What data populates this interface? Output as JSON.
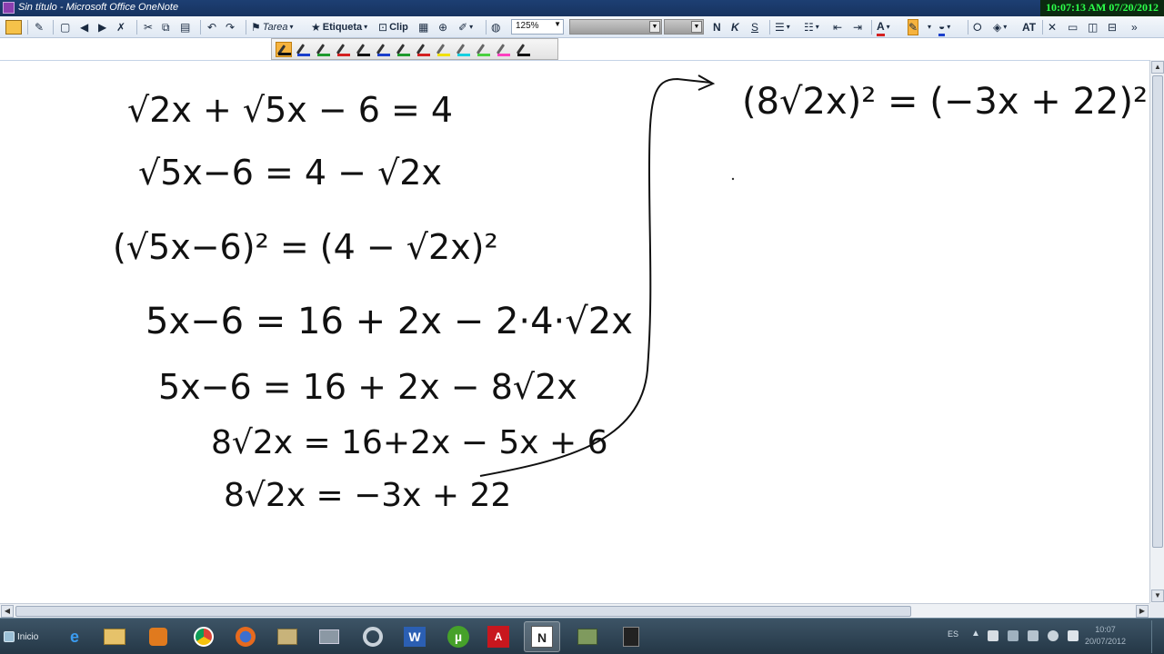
{
  "window": {
    "title": "Sin título - Microsoft Office OneNote",
    "clock": "10:07:13 AM 07/20/2012"
  },
  "toolbar": {
    "task_label": "Tarea",
    "tag_label": "Etiqueta",
    "clip_label": "Clip",
    "zoom_value": "125%",
    "font_size_label": "AT"
  },
  "pens": [
    {
      "color": "#111111",
      "selected": true
    },
    {
      "color": "#1a3fcc"
    },
    {
      "color": "#1f9a2e"
    },
    {
      "color": "#d42020"
    },
    {
      "color": "#111111"
    },
    {
      "color": "#1a3fcc"
    },
    {
      "color": "#1f9a2e"
    },
    {
      "color": "#d42020"
    },
    {
      "color": "#f0e000"
    },
    {
      "color": "#18d0e0"
    },
    {
      "color": "#4ad040"
    },
    {
      "color": "#ff40c0"
    },
    {
      "color": "#111111"
    }
  ],
  "notes": {
    "line1": "√2x + √5x − 6 = 4",
    "line2": "√5x−6 = 4 − √2x",
    "line3": "(√5x−6)² = (4 − √2x)²",
    "line4": "5x−6 = 16 + 2x − 2·4·√2x",
    "line5": "5x−6 = 16 + 2x − 8√2x",
    "line6": "8√2x = 16+2x − 5x + 6",
    "line7": "8√2x = −3x + 22",
    "right1": "(8√2x)² = (−3x + 22)²"
  },
  "taskbar": {
    "start_label": "Inicio",
    "language": "ES",
    "tray_time": "10:07",
    "tray_date": "20/07/2012"
  },
  "colors": {
    "accent": "#1d3f73",
    "ink": "#111111",
    "clock": "#2cff4a"
  }
}
